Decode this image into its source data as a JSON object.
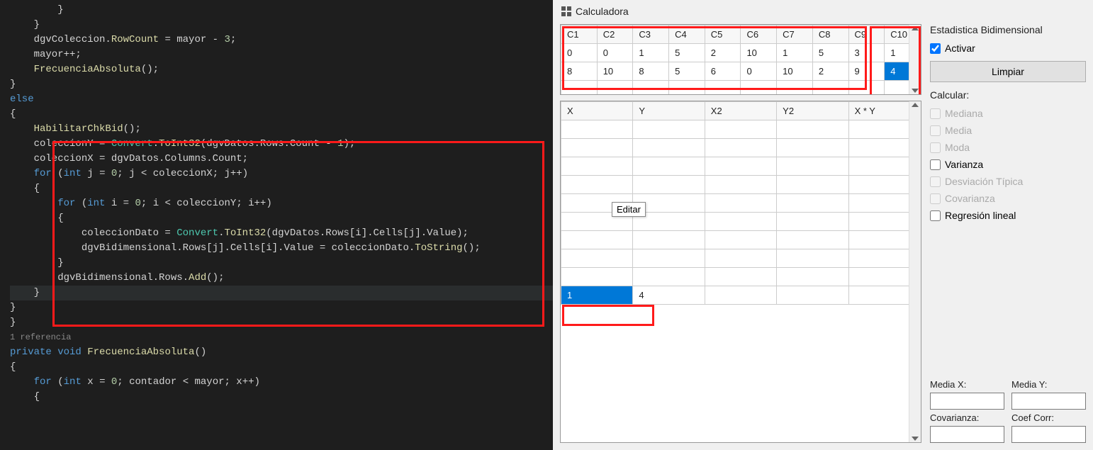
{
  "app": {
    "title": "Calculadora",
    "tooltip": "Editar"
  },
  "top_grid": {
    "headers": [
      "C1",
      "C2",
      "C3",
      "C4",
      "C5",
      "C6",
      "C7",
      "C8",
      "C9",
      "C10"
    ],
    "rows": [
      [
        "0",
        "0",
        "1",
        "5",
        "2",
        "10",
        "1",
        "5",
        "3",
        "1"
      ],
      [
        "8",
        "10",
        "8",
        "5",
        "6",
        "0",
        "10",
        "2",
        "9",
        "4"
      ]
    ],
    "selected": {
      "row": 1,
      "col": 9
    }
  },
  "bottom_grid": {
    "headers": [
      "X",
      "Y",
      "X2",
      "Y2",
      "X * Y"
    ],
    "rows": [
      [
        "",
        "",
        "",
        "",
        ""
      ],
      [
        "",
        "",
        "",
        "",
        ""
      ],
      [
        "",
        "",
        "",
        "",
        ""
      ],
      [
        "",
        "",
        "",
        "",
        ""
      ],
      [
        "",
        "",
        "",
        "",
        ""
      ],
      [
        "",
        "",
        "",
        "",
        ""
      ],
      [
        "",
        "",
        "",
        "",
        ""
      ],
      [
        "",
        "",
        "",
        "",
        ""
      ],
      [
        "",
        "",
        "",
        "",
        ""
      ],
      [
        "1",
        "4",
        "",
        "",
        ""
      ]
    ],
    "result_row_index": 9,
    "selected": {
      "row": 9,
      "col": 0
    }
  },
  "panel": {
    "section_title": "Estadistica Bidimensional",
    "activar_label": "Activar",
    "activar_checked": true,
    "limpiar_label": "Limpiar",
    "calcular_label": "Calcular:",
    "options": [
      {
        "label": "Mediana",
        "enabled": false,
        "checked": false
      },
      {
        "label": "Media",
        "enabled": false,
        "checked": false
      },
      {
        "label": "Moda",
        "enabled": false,
        "checked": false
      },
      {
        "label": "Varianza",
        "enabled": true,
        "checked": false
      },
      {
        "label": "Desviación Típica",
        "enabled": false,
        "checked": false
      },
      {
        "label": "Covarianza",
        "enabled": false,
        "checked": false
      },
      {
        "label": "Regresión lineal",
        "enabled": true,
        "checked": false
      }
    ],
    "outputs": {
      "media_x": "Media X:",
      "media_y": "Media Y:",
      "covarianza": "Covarianza:",
      "coef_corr": "Coef Corr:"
    }
  },
  "code": {
    "reference_hint": "1 referencia",
    "lines": [
      {
        "i": 2,
        "t": "        }"
      },
      {
        "i": 2,
        "t": "    }"
      },
      {
        "i": 0,
        "t": ""
      },
      {
        "i": 2,
        "seg": [
          {
            "t": "    dgvColeccion."
          },
          {
            "t": "RowCount",
            "c": "mtd"
          },
          {
            "t": " = mayor - "
          },
          {
            "t": "3",
            "c": "num"
          },
          {
            "t": ";"
          }
        ]
      },
      {
        "i": 2,
        "seg": [
          {
            "t": "    mayor++;"
          }
        ]
      },
      {
        "i": 2,
        "seg": [
          {
            "t": "    "
          },
          {
            "t": "FrecuenciaAbsoluta",
            "c": "mtd"
          },
          {
            "t": "();"
          }
        ]
      },
      {
        "i": 2,
        "t": "}"
      },
      {
        "i": 2,
        "seg": [
          {
            "t": "else",
            "c": "kw"
          }
        ]
      },
      {
        "i": 2,
        "t": "{"
      },
      {
        "i": 2,
        "seg": [
          {
            "t": "    "
          },
          {
            "t": "HabilitarChkBid",
            "c": "mtd"
          },
          {
            "t": "();"
          }
        ]
      },
      {
        "i": 2,
        "seg": [
          {
            "t": "    coleccionY = "
          },
          {
            "t": "Convert",
            "c": "cls"
          },
          {
            "t": "."
          },
          {
            "t": "ToInt32",
            "c": "mtd"
          },
          {
            "t": "(dgvDatos.Rows.Count - "
          },
          {
            "t": "1",
            "c": "num"
          },
          {
            "t": ");"
          }
        ]
      },
      {
        "i": 2,
        "seg": [
          {
            "t": "    coleccionX = dgvDatos.Columns.Count;"
          }
        ]
      },
      {
        "i": 0,
        "t": ""
      },
      {
        "i": 2,
        "seg": [
          {
            "t": "    "
          },
          {
            "t": "for",
            "c": "kw"
          },
          {
            "t": " ("
          },
          {
            "t": "int",
            "c": "kw"
          },
          {
            "t": " j = "
          },
          {
            "t": "0",
            "c": "num"
          },
          {
            "t": "; j < coleccionX; j++)"
          }
        ]
      },
      {
        "i": 2,
        "t": "    {",
        "hl": false
      },
      {
        "i": 2,
        "seg": [
          {
            "t": "        "
          },
          {
            "t": "for",
            "c": "kw"
          },
          {
            "t": " ("
          },
          {
            "t": "int",
            "c": "kw"
          },
          {
            "t": " i = "
          },
          {
            "t": "0",
            "c": "num"
          },
          {
            "t": "; i < coleccionY; i++)"
          }
        ]
      },
      {
        "i": 2,
        "t": "        {"
      },
      {
        "i": 2,
        "seg": [
          {
            "t": "            coleccionDato = "
          },
          {
            "t": "Convert",
            "c": "cls"
          },
          {
            "t": "."
          },
          {
            "t": "ToInt32",
            "c": "mtd"
          },
          {
            "t": "(dgvDatos.Rows[i].Cells[j].Value);"
          }
        ]
      },
      {
        "i": 2,
        "seg": [
          {
            "t": "            dgvBidimensional.Rows[j].Cells[i].Value = coleccionDato."
          },
          {
            "t": "ToString",
            "c": "mtd"
          },
          {
            "t": "();"
          }
        ]
      },
      {
        "i": 2,
        "t": "        }"
      },
      {
        "i": 2,
        "seg": [
          {
            "t": "        dgvBidimensional.Rows."
          },
          {
            "t": "Add",
            "c": "mtd"
          },
          {
            "t": "();"
          }
        ]
      },
      {
        "i": 2,
        "t": "    }",
        "hl": true
      },
      {
        "i": 2,
        "t": "}"
      },
      {
        "i": 0,
        "t": "}"
      },
      {
        "i": 0,
        "t": ""
      },
      {
        "ref": true
      },
      {
        "i": 0,
        "seg": [
          {
            "t": "private",
            "c": "kw"
          },
          {
            "t": " "
          },
          {
            "t": "void",
            "c": "kw"
          },
          {
            "t": " "
          },
          {
            "t": "FrecuenciaAbsoluta",
            "c": "mtd"
          },
          {
            "t": "()"
          }
        ]
      },
      {
        "i": 0,
        "t": "{"
      },
      {
        "i": 0,
        "seg": [
          {
            "t": "    "
          },
          {
            "t": "for",
            "c": "kw"
          },
          {
            "t": " ("
          },
          {
            "t": "int",
            "c": "kw"
          },
          {
            "t": " x = "
          },
          {
            "t": "0",
            "c": "num"
          },
          {
            "t": "; contador < mayor; x++)"
          }
        ]
      },
      {
        "i": 0,
        "t": "    {"
      }
    ]
  }
}
